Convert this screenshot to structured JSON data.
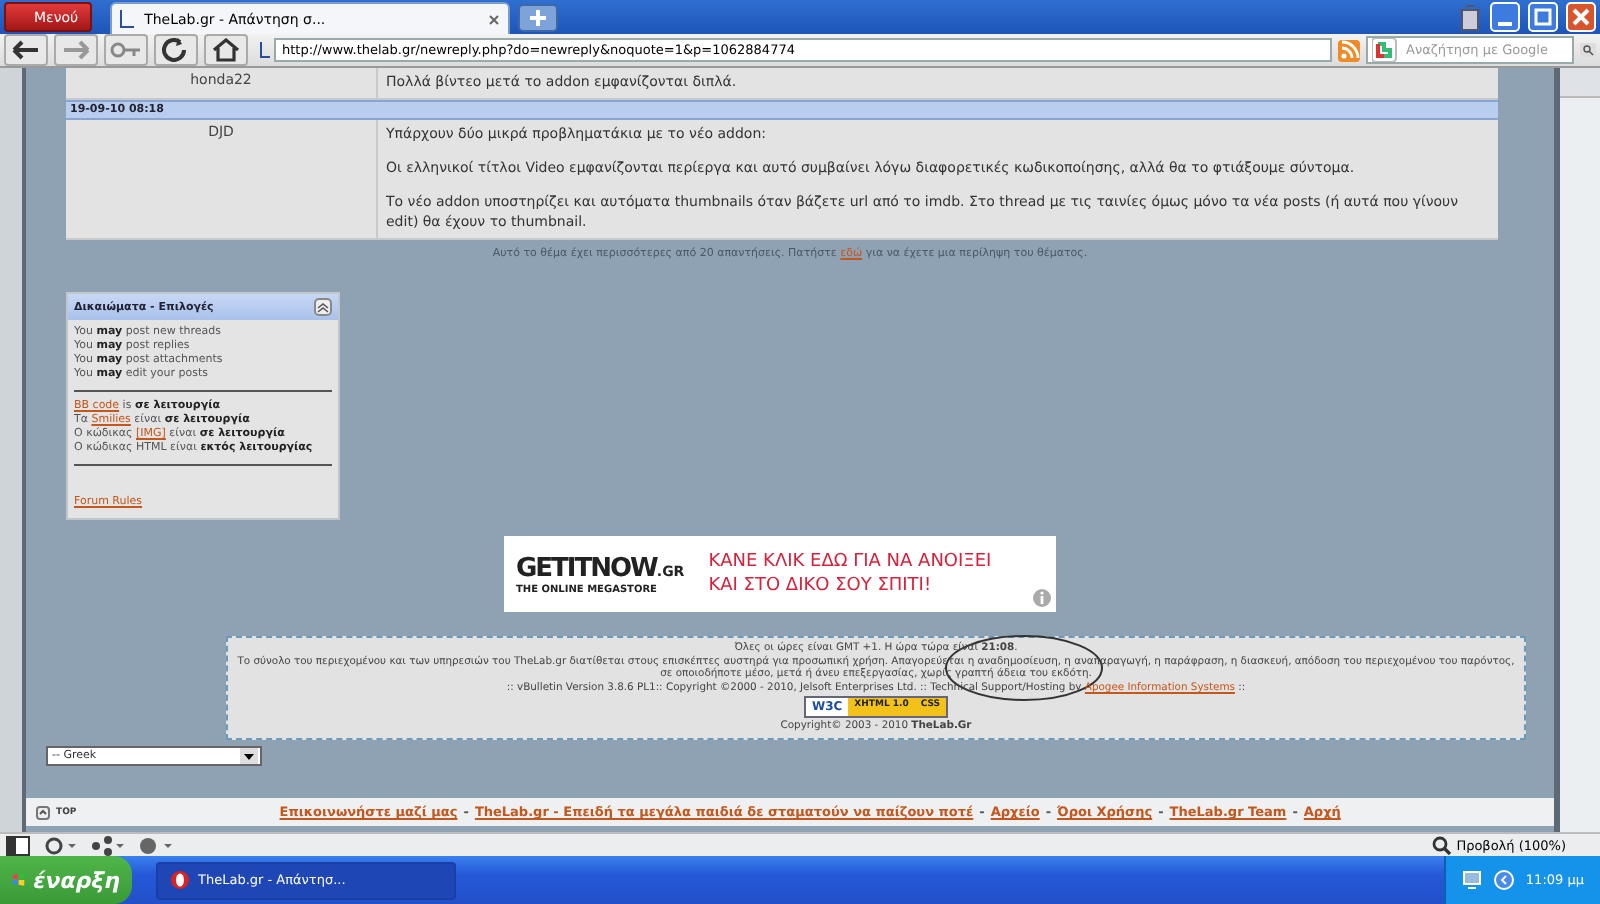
{
  "browser": {
    "menu_label": "Μενού",
    "tabs": [
      {
        "label": "TheLab.gr - Απάντηση σ...",
        "selected": true
      }
    ],
    "address": "http://www.thelab.gr/newreply.php?do=newreply&noquote=1&p=1062884774",
    "search": {
      "placeholder": "Αναζήτηση με Google"
    }
  },
  "posts": [
    {
      "kind": "post",
      "author": "honda22",
      "paragraphs": [
        "Πολλά βίντεο μετά το addon εμφανίζονται διπλά."
      ]
    },
    {
      "kind": "date",
      "date": "19-09-10 08:18"
    },
    {
      "kind": "post",
      "author": "DJD",
      "paragraphs": [
        "Υπάρχουν δύο μικρά προβληματάκια με το νέο addon:",
        "Οι ελληνικοί τίτλοι Video εμφανίζονται περίεργα και αυτό συμβαίνει λόγω διαφορετικές κωδικοποίησης, αλλά θα το φτιάξουμε σύντομα.",
        "Το νέο addon υποστηρίζει και αυτόματα thumbnails όταν βάζετε url από το imdb. Στο thread με τις ταινίες όμως μόνο τα νέα posts (ή αυτά που γίνουν edit) θα έχουν το thumbnail."
      ]
    }
  ],
  "thread_note": {
    "before": "Αυτό το θέμα έχει περισσότερες από 20 απαντήσεις. Πατήστε ",
    "link": "εδώ",
    "after": " για να έχετε μια περίληψη του θέματος."
  },
  "permissions": {
    "title": "Δικαιώματα - Επιλογές",
    "lines": [
      "You **may** post new threads",
      "You **may** post replies",
      "You **may** post attachments",
      "You **may** edit your posts"
    ],
    "settings": [
      {
        "link": "BB code",
        "after": " is **σε λειτουργία**"
      },
      {
        "before": "Τα ",
        "link": "Smilies",
        "after": " είναι **σε λειτουργία**"
      },
      {
        "before": "Ο κώδικας ",
        "link": "[IMG]",
        "after": " είναι **σε λειτουργία**"
      },
      {
        "before": "Ο κώδικας HTML είναι **εκτός λειτουργίας**"
      }
    ],
    "rules_link": "Forum Rules"
  },
  "ad": {
    "logo": "GETITNOW",
    "logo_suffix": ".GR",
    "tagline": "THE ONLINE MEGASTORE",
    "lines": [
      "ΚΑΝΕ ΚΛΙΚ ΕΔΩ ΓΙΑ ΝΑ ΑΝΟΙΞΕΙ",
      "ΚΑΙ ΣΤΟ ΔΙΚΟ ΣΟΥ ΣΠΙΤΙ!"
    ]
  },
  "footer": {
    "time_line": "Όλες οι ώρες είναι GMT +1. Η ώρα τώρα είναι **21:08**.",
    "notice": "Το σύνολο του περιεχομένου και των υπηρεσιών του TheLab.gr διατίθεται στους επισκέπτες αυστηρά για προσωπική χρήση. Απαγορεύεται η αναδημοσίευση, η αναπαραγωγή, η παράφραση, η διασκευή, απόδοση του περιεχομένου του παρόντος, σε οποιοδήποτε μέσο, μετά ή άνευ επεξεργασίας, χωρίς γραπτή άδεια του εκδότη.",
    "version": {
      "before": ":: vBulletin Version 3.8.6 PL1:: Copyright ©2000 - 2010, Jelsoft Enterprises Ltd. :: Technical Support/Hosting by ",
      "link": "Apogee Information Systems",
      "after": " ::"
    },
    "badges": [
      "W3C",
      "XHTML 1.0",
      "CSS"
    ],
    "copyright": "Copyright© 2003 - 2010 **TheLab.Gr**"
  },
  "language_select": {
    "value": "-- Greek"
  },
  "bottom_bar": {
    "top_label": "TOP",
    "separator": "-",
    "links": [
      "Επικοινωνήστε μαζί μας",
      "TheLab.gr - Επειδή τα μεγάλα παιδιά δε σταματούν να παίζουν ποτέ",
      "Αρχείο",
      "Όροι Χρήσης",
      "TheLab.gr Team",
      "Αρχή"
    ]
  },
  "status_bar": {
    "zoom": "Προβολή (100%)"
  },
  "taskbar": {
    "start": "έναρξη",
    "tasks": [
      {
        "label": "TheLab.gr - Απάντησ...",
        "selected": true
      }
    ],
    "clock": "11:09 μμ"
  }
}
